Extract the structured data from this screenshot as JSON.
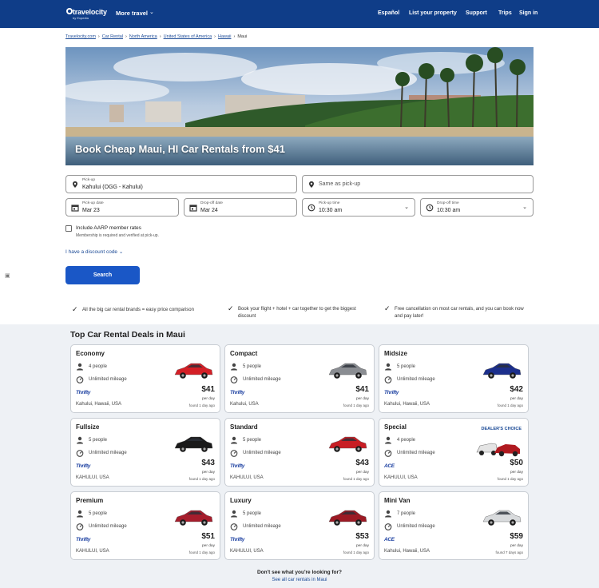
{
  "header": {
    "logo_text": "travelocity",
    "logo_sub": "by Expedia",
    "more_travel": "More travel",
    "nav": [
      "Español",
      "List your property",
      "Support",
      "Trips",
      "Sign in"
    ]
  },
  "breadcrumb": [
    "Travelocity.com",
    "Car Rental",
    "North America",
    "United States of America",
    "Hawaii",
    "Maui"
  ],
  "hero": {
    "title": "Book Cheap Maui, HI Car Rentals from $41"
  },
  "form": {
    "pickup": {
      "label": "Pick-up",
      "value": "Kahului (OGG - Kahului)"
    },
    "dropoff": {
      "placeholder": "Same as pick-up"
    },
    "pickup_date": {
      "label": "Pick-up date",
      "value": "Mar 23"
    },
    "dropoff_date": {
      "label": "Drop-off date",
      "value": "Mar 24"
    },
    "pickup_time": {
      "label": "Pick-up time",
      "value": "10:30 am"
    },
    "dropoff_time": {
      "label": "Drop-off time",
      "value": "10:30 am"
    },
    "aarp_label": "Include AARP member rates",
    "aarp_sub": "Membership is required and verified at pick-up.",
    "discount": "I have a discount code",
    "search": "Search"
  },
  "benefits": [
    "All the big car rental brands = easy price comparison",
    "Book your flight + hotel + car together to get the biggest discount",
    "Free cancellation on most car rentals, and you can book now and pay later!"
  ],
  "deals": {
    "title": "Top Car Rental Deals in Maui",
    "per_day": "per day",
    "mileage": "Unlimited mileage",
    "cards": [
      {
        "title": "Economy",
        "people": "4 people",
        "brand": "Thrifty",
        "location": "Kahului, Hawaii, USA",
        "price": "$41",
        "found": "found 1 day ago",
        "car_color": "#d41f26"
      },
      {
        "title": "Compact",
        "people": "5 people",
        "brand": "Thrifty",
        "location": "Kahului, USA",
        "price": "$41",
        "found": "found 1 day ago",
        "car_color": "#8a8d92"
      },
      {
        "title": "Midsize",
        "people": "5 people",
        "brand": "Thrifty",
        "location": "Kahului, Hawaii, USA",
        "price": "$42",
        "found": "found 1 day ago",
        "car_color": "#1c2f8c"
      },
      {
        "title": "Fullsize",
        "people": "5 people",
        "brand": "Thrifty",
        "location": "KAHULUI, USA",
        "price": "$43",
        "found": "found 1 day ago",
        "car_color": "#1a1a1a"
      },
      {
        "title": "Standard",
        "people": "5 people",
        "brand": "Thrifty",
        "location": "KAHULUI, USA",
        "price": "$43",
        "found": "found 1 day ago",
        "car_color": "#c81e24"
      },
      {
        "title": "Special",
        "people": "4 people",
        "brand": "ACE",
        "location": "KAHULUI, USA",
        "price": "$50",
        "found": "found 1 day ago",
        "car_color": "#b01a20",
        "dealer": "DEALER'S CHOICE"
      },
      {
        "title": "Premium",
        "people": "5 people",
        "brand": "Thrifty",
        "location": "KAHULUI, USA",
        "price": "$51",
        "found": "found 1 day ago",
        "car_color": "#a61d2c"
      },
      {
        "title": "Luxury",
        "people": "5 people",
        "brand": "Thrifty",
        "location": "KAHULUI, USA",
        "price": "$53",
        "found": "found 1 day ago",
        "car_color": "#9c1a24"
      },
      {
        "title": "Mini Van",
        "people": "7 people",
        "brand": "ACE",
        "location": "Kahului, Hawaii, USA",
        "price": "$59",
        "found": "found 7 days ago",
        "car_color": "#d8dadc"
      }
    ]
  },
  "footer": {
    "question": "Don't see what you're looking for?",
    "link": "See all car rentals in Maui"
  }
}
